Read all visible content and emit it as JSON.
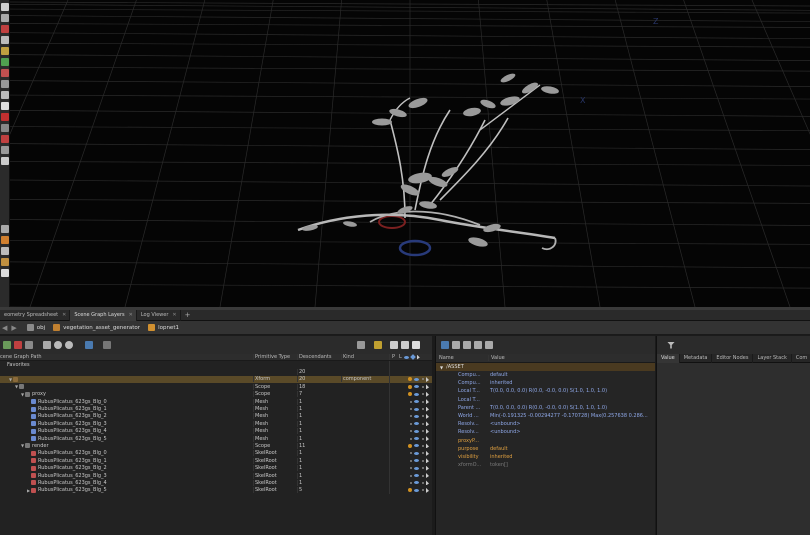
{
  "tabs": [
    {
      "label": "eometry Spreadsheet",
      "active": false
    },
    {
      "label": "Scene Graph Layers",
      "active": false
    },
    {
      "label": "Log Viewer",
      "active": false
    }
  ],
  "tab_add_label": "+",
  "path_bar": {
    "items": [
      {
        "label": "obj",
        "icon": "network-icon"
      },
      {
        "label": "vegetation_asset_generator",
        "icon": "geo-node-icon"
      },
      {
        "label": "lopnet1",
        "icon": "lop-network-icon"
      }
    ]
  },
  "viewport": {
    "fx_label": "fx",
    "axis_labels": [
      "Z",
      "X"
    ]
  },
  "scene_tree": {
    "columns": [
      "cene Graph Path",
      "Primitive Type",
      "Descendants",
      "Kind",
      "P",
      "L"
    ],
    "rows": [
      {
        "name": "Favorites",
        "type": "",
        "desc": "",
        "kind": "",
        "depth": 0,
        "arrow": "",
        "icon": "",
        "flags": false
      },
      {
        "name": "",
        "type": "",
        "desc": "20",
        "kind": "",
        "depth": 0,
        "arrow": "",
        "icon": "",
        "flags": false
      },
      {
        "name": "",
        "type": "Xform",
        "desc": "20",
        "kind": "component",
        "depth": 1,
        "arrow": "▼",
        "icon": "#8a6a3a",
        "flags": true,
        "selected": true
      },
      {
        "name": "",
        "type": "Scope",
        "desc": "18",
        "kind": "",
        "depth": 2,
        "arrow": "▼",
        "icon": "#777",
        "flags": true
      },
      {
        "name": "proxy",
        "type": "Scope",
        "desc": "7",
        "kind": "",
        "depth": 3,
        "arrow": "▼",
        "icon": "#777",
        "flags": true
      },
      {
        "name": "RubusPlicatus_623gs_Blg_0",
        "type": "Mesh",
        "desc": "1",
        "kind": "",
        "depth": 4,
        "arrow": "",
        "icon": "#6a8ad0",
        "flags": true
      },
      {
        "name": "RubusPlicatus_623gs_Blg_1",
        "type": "Mesh",
        "desc": "1",
        "kind": "",
        "depth": 4,
        "arrow": "",
        "icon": "#6a8ad0",
        "flags": true
      },
      {
        "name": "RubusPlicatus_623gs_Blg_2",
        "type": "Mesh",
        "desc": "1",
        "kind": "",
        "depth": 4,
        "arrow": "",
        "icon": "#6a8ad0",
        "flags": true
      },
      {
        "name": "RubusPlicatus_623gs_Blg_3",
        "type": "Mesh",
        "desc": "1",
        "kind": "",
        "depth": 4,
        "arrow": "",
        "icon": "#6a8ad0",
        "flags": true
      },
      {
        "name": "RubusPlicatus_623gs_Blg_4",
        "type": "Mesh",
        "desc": "1",
        "kind": "",
        "depth": 4,
        "arrow": "",
        "icon": "#6a8ad0",
        "flags": true
      },
      {
        "name": "RubusPlicatus_623gs_Blg_5",
        "type": "Mesh",
        "desc": "1",
        "kind": "",
        "depth": 4,
        "arrow": "",
        "icon": "#6a8ad0",
        "flags": true
      },
      {
        "name": "render",
        "type": "Scope",
        "desc": "11",
        "kind": "",
        "depth": 3,
        "arrow": "▼",
        "icon": "#777",
        "flags": true
      },
      {
        "name": "RubusPlicatus_623gs_Blg_0",
        "type": "SkelRoot",
        "desc": "1",
        "kind": "",
        "depth": 4,
        "arrow": "",
        "icon": "#c05050",
        "flags": true
      },
      {
        "name": "RubusPlicatus_623gs_Blg_1",
        "type": "SkelRoot",
        "desc": "1",
        "kind": "",
        "depth": 4,
        "arrow": "",
        "icon": "#c05050",
        "flags": true
      },
      {
        "name": "RubusPlicatus_623gs_Blg_2",
        "type": "SkelRoot",
        "desc": "1",
        "kind": "",
        "depth": 4,
        "arrow": "",
        "icon": "#c05050",
        "flags": true
      },
      {
        "name": "RubusPlicatus_623gs_Blg_3",
        "type": "SkelRoot",
        "desc": "1",
        "kind": "",
        "depth": 4,
        "arrow": "",
        "icon": "#c05050",
        "flags": true
      },
      {
        "name": "RubusPlicatus_623gs_Blg_4",
        "type": "SkelRoot",
        "desc": "1",
        "kind": "",
        "depth": 4,
        "arrow": "",
        "icon": "#c05050",
        "flags": true
      },
      {
        "name": "RubusPlicatus_623gs_Blg_5",
        "type": "SkelRoot",
        "desc": "5",
        "kind": "",
        "depth": 4,
        "arrow": "▶",
        "icon": "#c05050",
        "flags": true
      }
    ]
  },
  "properties": {
    "header_name": "Name",
    "header_value": "Value",
    "asset_path": "/ASSET",
    "rows": [
      {
        "name": "Compu...",
        "value": "default",
        "style": "blue"
      },
      {
        "name": "Compu...",
        "value": "inherited",
        "style": "blue"
      },
      {
        "name": "Local T...",
        "value": "T(0.0, 0.0, 0.0) R(0.0, -0.0, 0.0) S(1.0, 1.0, 1.0)",
        "style": "blue"
      },
      {
        "name": "Local T...",
        "value": "",
        "style": "blue"
      },
      {
        "name": "Parent ...",
        "value": "T(0.0, 0.0, 0.0) R(0.0, -0.0, 0.0) S(1.0, 1.0, 1.0)",
        "style": "blue"
      },
      {
        "name": "World ...",
        "value": "Min(-0.191325 -0.00294277 -0.170728) Max(0.257638 0.286...",
        "style": "blue"
      },
      {
        "name": "Resolv...",
        "value": "<unbound>",
        "style": "blue"
      },
      {
        "name": "Resolv...",
        "value": "<unbound>",
        "style": "blue"
      },
      {
        "name": "proxyP...",
        "value": "",
        "style": "orange"
      },
      {
        "name": "purpose",
        "value": "default",
        "style": "orange"
      },
      {
        "name": "visibility",
        "value": "inherited",
        "style": "orange"
      },
      {
        "name": "xformO...",
        "value": "token[]",
        "style": "dim"
      }
    ]
  },
  "right_panel": {
    "tabs": [
      "Value",
      "Metadata",
      "Editor Nodes",
      "Layer Stack",
      "Com"
    ]
  },
  "colors": {
    "viewport_bg": "#050505",
    "grid": "#2a2a2a",
    "selection": "#5a4a28",
    "prop_blue": "#8fa8e8",
    "prop_orange": "#e0a040"
  }
}
